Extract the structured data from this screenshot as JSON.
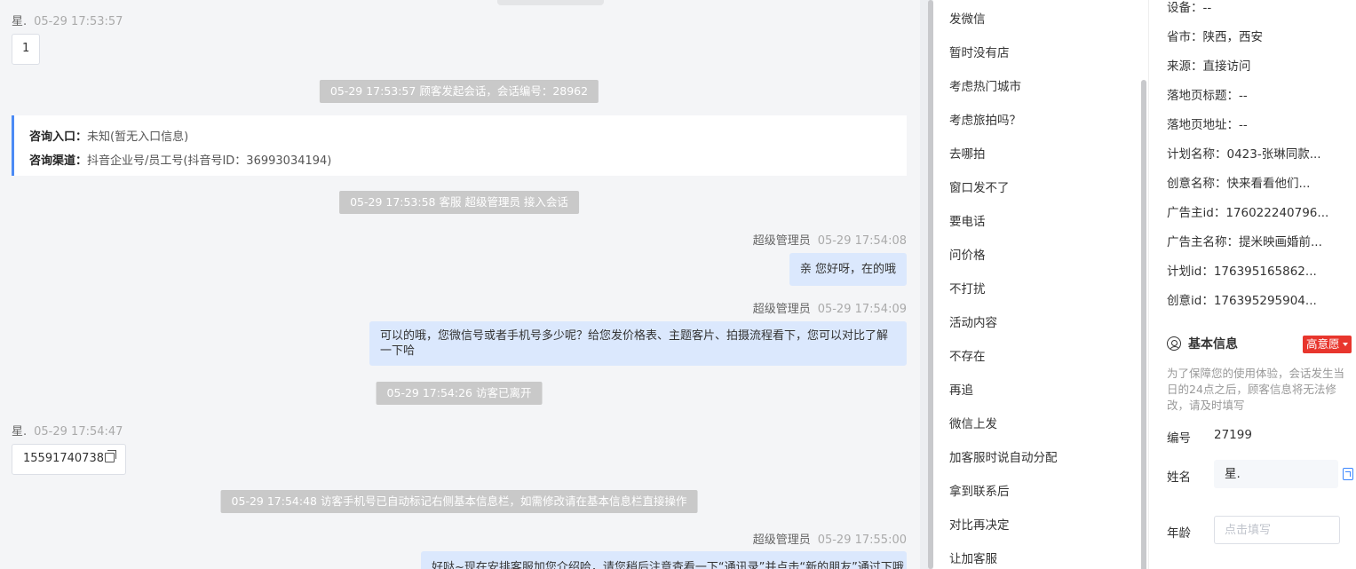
{
  "chat": {
    "messages": [
      {
        "sender": "星.",
        "time": "05-29 17:53:57",
        "text": "1"
      },
      {
        "system": "05-29 17:53:57 顾客发起会话，会话编号：28962"
      },
      {
        "entry_label": "咨询入口：",
        "entry_value": "未知(暂无入口信息)",
        "channel_label": "咨询渠道：",
        "channel_value": "抖音企业号/员工号(抖音号ID：36993034194)"
      },
      {
        "system": "05-29 17:53:58 客服 超级管理员 接入会话"
      },
      {
        "sender": "超级管理员",
        "time": "05-29 17:54:08",
        "text": "亲 您好呀，在的哦"
      },
      {
        "sender": "超级管理员",
        "time": "05-29 17:54:09",
        "text": "可以的哦，您微信号或者手机号多少呢？给您发价格表、主题客片、拍摄流程看下，您可以对比了解一下哈"
      },
      {
        "system": "05-29 17:54:26 访客已离开"
      },
      {
        "sender": "星.",
        "time": "05-29 17:54:47",
        "text": "15591740738"
      },
      {
        "system": "05-29 17:54:48 访客手机号已自动标记右侧基本信息栏，如需修改请在基本信息栏直接操作"
      },
      {
        "sender": "超级管理员",
        "time": "05-29 17:55:00",
        "text": "好哒~现在安排客服加您介绍哈，请您稍后注意查看一下“通讯录”并点击“新的朋友”通过下哦"
      }
    ]
  },
  "quick_replies": [
    "发微信",
    "暂时没有店",
    "考虑热门城市",
    "考虑旅拍吗？",
    "去哪拍",
    "窗口发不了",
    "要电话",
    "问价格",
    "不打扰",
    "活动内容",
    "不存在",
    "再追",
    "微信上发",
    "加客服时说自动分配",
    "拿到联系后",
    "对比再决定",
    "让加客服"
  ],
  "visitor_info": [
    {
      "k": "设备：",
      "v": "--"
    },
    {
      "k": "省市：",
      "v": "陕西，西安"
    },
    {
      "k": "来源：",
      "v": "直接访问"
    },
    {
      "k": "落地页标题：",
      "v": "--"
    },
    {
      "k": "落地页地址：",
      "v": "--"
    },
    {
      "k": "计划名称：",
      "v": "0423-张琳同款..."
    },
    {
      "k": "创意名称：",
      "v": "快来看看他们..."
    },
    {
      "k": "广告主id：",
      "v": "176022240796..."
    },
    {
      "k": "广告主名称：",
      "v": "提米映画婚前..."
    },
    {
      "k": "计划id：",
      "v": "176395165862..."
    },
    {
      "k": "创意id：",
      "v": "176395295904..."
    }
  ],
  "basic_info": {
    "title": "基本信息",
    "intent": "高意愿",
    "notice": "为了保障您的使用体验，会话发生当日的24点之后，顾客信息将无法修改，请及时填写",
    "id_label": "编号",
    "id_value": "27199",
    "name_label": "姓名",
    "name_value": "星.",
    "age_label": "年龄",
    "age_placeholder": "点击填写"
  },
  "colors": {
    "accent": "#4c8bf5",
    "bubble_agent": "#dbe8fd",
    "system_tag": "#c9c9c9",
    "intent_badge": "#e8362d"
  },
  "icons": {
    "copy": "copy-icon",
    "user": "user-circle-icon",
    "edit": "edit-icon",
    "caret": "caret-down-icon"
  }
}
